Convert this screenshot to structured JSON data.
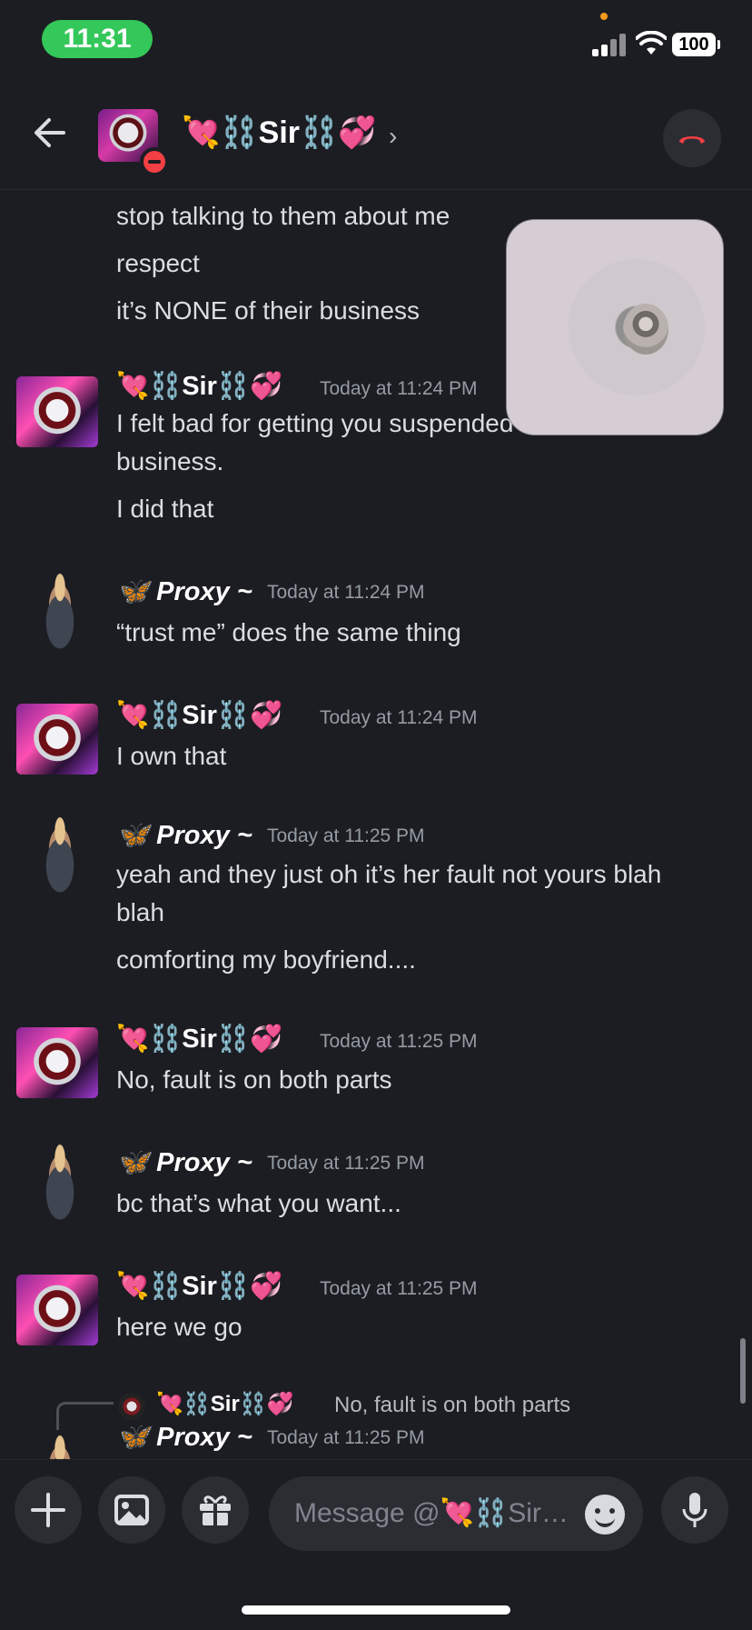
{
  "status_bar": {
    "time": "11:31",
    "battery": "100"
  },
  "header": {
    "name": "💘⛓️Sir⛓️💞",
    "chevron": "›",
    "icons": {
      "back": "back-arrow-icon",
      "call": "end-call-icon"
    }
  },
  "messages": {
    "cont1": {
      "lines": [
        "stop talking to them about me",
        "respect",
        "it’s NONE of their business"
      ]
    },
    "m1": {
      "author": "💘⛓️Sir⛓️💞",
      "timestamp": "Today at 11:24 PM",
      "lines": [
        "I felt bad for getting you suspended",
        "business.",
        "I did that"
      ]
    },
    "m2": {
      "author": "🦋 Proxy ~",
      "timestamp": "Today at 11:24 PM",
      "lines": [
        "“trust me” does the same thing"
      ]
    },
    "m3": {
      "author": "💘⛓️Sir⛓️💞",
      "timestamp": "Today at 11:24 PM",
      "lines": [
        "I own that"
      ]
    },
    "m4": {
      "author": "🦋 Proxy ~",
      "timestamp": "Today at 11:25 PM",
      "lines": [
        "yeah and they just oh it’s her fault not yours blah",
        "blah",
        "comforting my boyfriend...."
      ]
    },
    "m5": {
      "author": "💘⛓️Sir⛓️💞",
      "timestamp": "Today at 11:25 PM",
      "lines": [
        "No, fault is on both parts"
      ]
    },
    "m6": {
      "author": "🦋 Proxy ~",
      "timestamp": "Today at 11:25 PM",
      "lines": [
        "bc that’s what you want..."
      ]
    },
    "m7": {
      "author": "💘⛓️Sir⛓️💞",
      "timestamp": "Today at 11:25 PM",
      "lines": [
        "here we go"
      ]
    },
    "m8": {
      "author": "🦋 Proxy ~",
      "timestamp": "Today at 11:25 PM",
      "reply": {
        "author": "💘⛓️Sir⛓️💞",
        "text": "No, fault is on both parts"
      }
    }
  },
  "composer": {
    "placeholder": "Message @💘⛓️Sir…",
    "icons": {
      "add": "plus-icon",
      "media": "image-icon",
      "gift": "gift-icon",
      "emoji": "emoji-icon",
      "voice": "microphone-icon"
    }
  }
}
